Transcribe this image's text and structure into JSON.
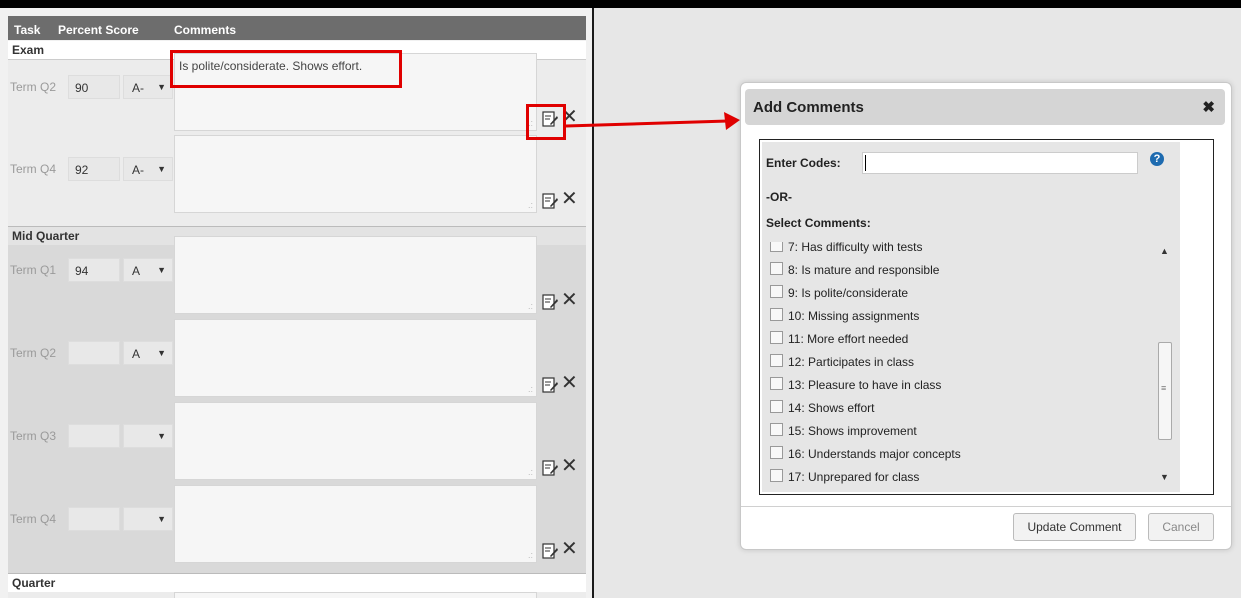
{
  "header": {
    "task": "Task",
    "percent": "Percent Score",
    "comments": "Comments"
  },
  "sections": {
    "exam": "Exam",
    "mid_quarter": "Mid Quarter",
    "quarter": "Quarter"
  },
  "rows": [
    {
      "term": "Term Q2",
      "percent": "90",
      "score": "A-",
      "comment": "Is polite/considerate.  Shows effort."
    },
    {
      "term": "Term Q4",
      "percent": "92",
      "score": "A-",
      "comment": ""
    },
    {
      "term": "Term Q1",
      "percent": "94",
      "score": "A",
      "comment": ""
    },
    {
      "term": "Term Q2",
      "percent": "",
      "score": "A",
      "comment": ""
    },
    {
      "term": "Term Q3",
      "percent": "",
      "score": "",
      "comment": ""
    },
    {
      "term": "Term Q4",
      "percent": "",
      "score": "",
      "comment": ""
    }
  ],
  "dialog": {
    "title": "Add Comments",
    "close": "✖",
    "enter_codes_label": "Enter Codes:",
    "codes_value": "",
    "help": "?",
    "or_label": "-OR-",
    "select_label": "Select Comments:",
    "comments": [
      "7: Has difficulty with tests",
      "8: Is mature and responsible",
      "9: Is polite/considerate",
      "10: Missing assignments",
      "11: More effort needed",
      "12: Participates in class",
      "13: Pleasure to have in class",
      "14: Shows effort",
      "15: Shows improvement",
      "16: Understands major concepts",
      "17: Unprepared for class"
    ],
    "update_button": "Update Comment",
    "cancel_button": "Cancel"
  },
  "colors": {
    "highlight": "#e00000",
    "help_icon": "#1e6bb0"
  },
  "icons": {
    "edit": "edit-comment-icon",
    "delete": "delete-icon",
    "close": "close-icon",
    "help": "help-icon"
  }
}
